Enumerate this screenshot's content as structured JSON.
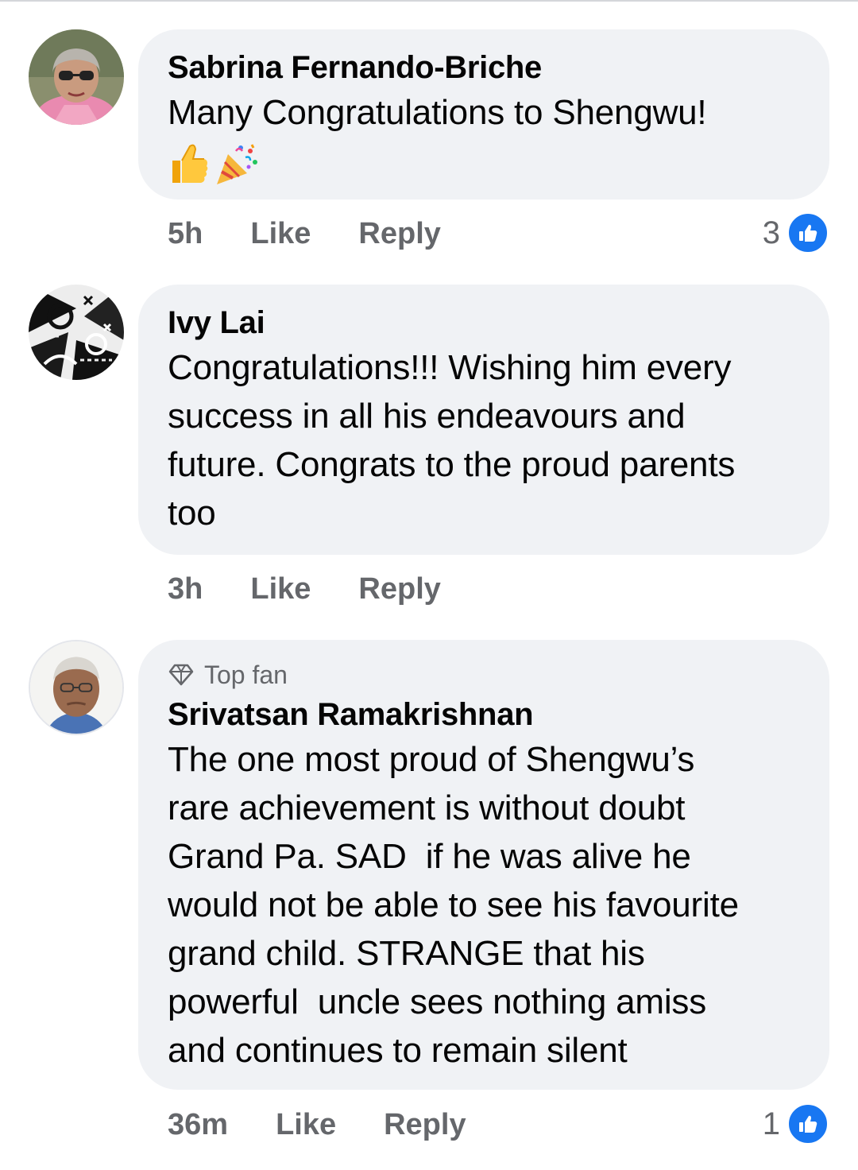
{
  "comments": [
    {
      "author": "Sabrina Fernando-Briche",
      "text": "Many Congratulations to Shengwu!",
      "emojis": [
        "thumbs-up-emoji",
        "party-popper-emoji"
      ],
      "time": "5h",
      "like_label": "Like",
      "reply_label": "Reply",
      "reaction_count": "3",
      "reaction_icon": "like-reaction-icon"
    },
    {
      "author": "Ivy Lai",
      "text": "Congratulations!!! Wishing him every\nsuccess in all his endeavours and\nfuture. Congrats to the proud parents\ntoo",
      "time": "3h",
      "like_label": "Like",
      "reply_label": "Reply"
    },
    {
      "badge": "Top fan",
      "badge_icon": "diamond-icon",
      "author": "Srivatsan Ramakrishnan",
      "text": "The one most proud of Shengwu’s\nrare achievement is without doubt\nGrand Pa. SAD  if he was alive he\nwould not be able to see his favourite\ngrand child. STRANGE that his\npowerful  uncle sees nothing amiss\nand continues to remain silent",
      "time": "36m",
      "like_label": "Like",
      "reply_label": "Reply",
      "reaction_count": "1",
      "reaction_icon": "like-reaction-icon"
    }
  ],
  "colors": {
    "bubble": "#f0f2f5",
    "meta_text": "#65676b",
    "like_blue": "#1877f2",
    "body_text": "#050505"
  }
}
